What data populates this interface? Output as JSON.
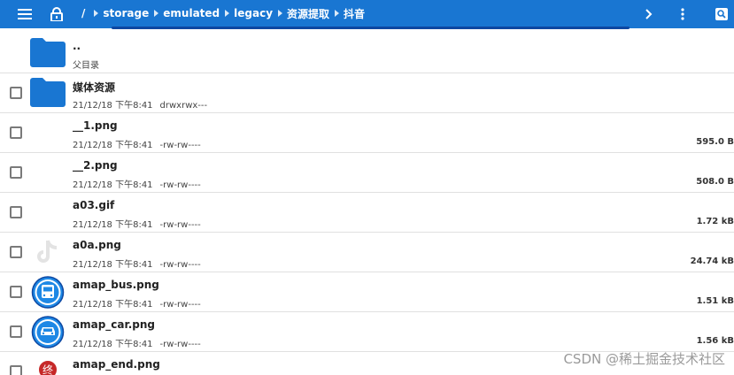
{
  "toolbar": {
    "path": [
      "storage",
      "emulated",
      "legacy",
      "资源提取",
      "抖音"
    ],
    "root_label": "/",
    "bg": "#1976d2"
  },
  "parent": {
    "name": "..",
    "label": "父目录"
  },
  "files": [
    {
      "name": "媒体资源",
      "date": "21/12/18 下午8:41",
      "perm": "drwxrwx---",
      "size": "",
      "thumb": "folder"
    },
    {
      "name": "__1.png",
      "date": "21/12/18 下午8:41",
      "perm": "-rw-rw----",
      "size": "595.0 B",
      "thumb": "none"
    },
    {
      "name": "__2.png",
      "date": "21/12/18 下午8:41",
      "perm": "-rw-rw----",
      "size": "508.0 B",
      "thumb": "none"
    },
    {
      "name": "a03.gif",
      "date": "21/12/18 下午8:41",
      "perm": "-rw-rw----",
      "size": "1.72 kB",
      "thumb": "none"
    },
    {
      "name": "a0a.png",
      "date": "21/12/18 下午8:41",
      "perm": "-rw-rw----",
      "size": "24.74 kB",
      "thumb": "tiktok"
    },
    {
      "name": "amap_bus.png",
      "date": "21/12/18 下午8:41",
      "perm": "-rw-rw----",
      "size": "1.51 kB",
      "thumb": "bus"
    },
    {
      "name": "amap_car.png",
      "date": "21/12/18 下午8:41",
      "perm": "-rw-rw----",
      "size": "1.56 kB",
      "thumb": "car"
    },
    {
      "name": "amap_end.png",
      "date": "",
      "perm": "",
      "size": "",
      "thumb": "end"
    }
  ],
  "watermark": "CSDN @稀土掘金技术社区",
  "end_icon_text": "终"
}
